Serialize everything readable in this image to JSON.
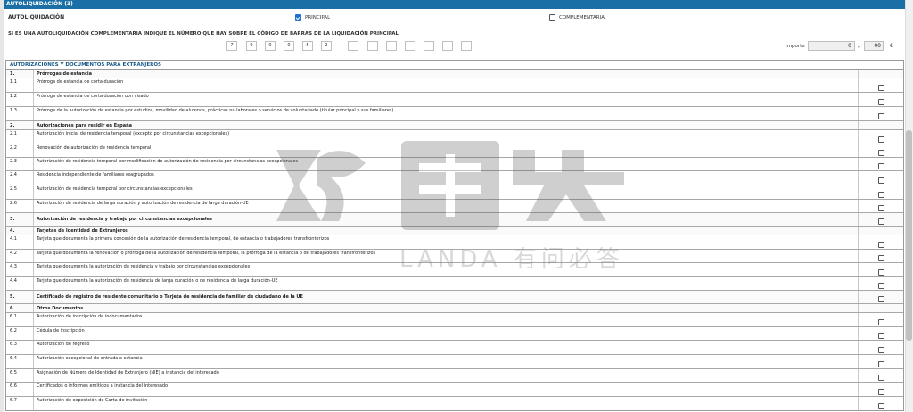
{
  "header": {
    "title": "AUTOLIQUIDACIÓN (3)"
  },
  "autoliquidacion": {
    "label": "AUTOLIQUIDACIÓN",
    "principal_label": "PRINCIPAL",
    "principal_checked": true,
    "complementaria_label": "COMPLEMENTARIA",
    "complementaria_checked": false
  },
  "complementaria_note": "SI ES UNA AUTOLIQUIDACIÓN COMPLEMENTARIA INDIQUE EL NÚMERO QUE HAY SOBRE EL CÓDIGO DE BARRAS DE LA LIQUIDACIÓN PRINCIPAL",
  "barcode_digits": [
    "7",
    "9",
    "0",
    "0",
    "5",
    "2",
    "",
    "",
    "",
    "",
    "",
    "",
    ""
  ],
  "importe": {
    "label": "Importe",
    "integer": "0",
    "separator": ",",
    "decimal": "00",
    "currency": "€"
  },
  "autorizaciones": {
    "title": "AUTORIZACIONES Y DOCUMENTOS PARA EXTRANJEROS",
    "rows": [
      {
        "num": "1.",
        "desc": "Prórrogas de estancia",
        "category": true,
        "checkbox": false,
        "h": 10
      },
      {
        "num": "1.1",
        "desc": "Prórroga de estancia de corta duración",
        "category": false,
        "checkbox": true,
        "h": 16
      },
      {
        "num": "1.2",
        "desc": "Prórroga de estancia de corta duración con visado",
        "category": false,
        "checkbox": true,
        "h": 16
      },
      {
        "num": "1.3",
        "desc": "Prórroga de la autorización de estancia por estudios, movilidad de alumnos, prácticas no laborales o servicios de voluntariado (titular principal y sus familiares)",
        "category": false,
        "checkbox": true,
        "h": 16
      },
      {
        "num": "2.",
        "desc": "Autorizaciones para residir en España",
        "category": true,
        "checkbox": false,
        "h": 10
      },
      {
        "num": "2.1",
        "desc": "Autorización inicial de residencia temporal (excepto por circunstancias excepcionales)",
        "category": false,
        "checkbox": true,
        "h": 16
      },
      {
        "num": "2.2",
        "desc": "Renovación de autorización de residencia temporal",
        "category": false,
        "checkbox": true,
        "h": 15
      },
      {
        "num": "2.3",
        "desc": "Autorización de residencia temporal por modificación de autorización de residencia por circunstancias excepcionales",
        "category": false,
        "checkbox": true,
        "h": 15
      },
      {
        "num": "2.4",
        "desc": "Residencia independiente de familiares reagrupados",
        "category": false,
        "checkbox": true,
        "h": 16
      },
      {
        "num": "2.5",
        "desc": "Autorización de residencia temporal por circunstancias excepcionales",
        "category": false,
        "checkbox": true,
        "h": 16
      },
      {
        "num": "2.6",
        "desc": "Autorización de residencia de larga duración y autorización de residencia de larga duración-UE",
        "category": false,
        "checkbox": true,
        "h": 15
      },
      {
        "num": "3.",
        "desc": "Autorización de residencia y trabajo por circunstancias excepcionales",
        "category": true,
        "checkbox": true,
        "h": 15
      },
      {
        "num": "4.",
        "desc": "Tarjetas de Identidad de Extranjeros",
        "category": true,
        "checkbox": false,
        "h": 10
      },
      {
        "num": "4.1",
        "desc": "Tarjeta que documenta la primera concesión de la autorización de residencia temporal, de estancia o trabajadores transfronterizos",
        "category": false,
        "checkbox": true,
        "h": 16
      },
      {
        "num": "4.2",
        "desc": "Tarjeta que documenta la renovación o prórroga de la autorización de residencia temporal, la prórroga de la estancia o de trabajadores transfronterizos",
        "category": false,
        "checkbox": true,
        "h": 15
      },
      {
        "num": "4.3",
        "desc": "Tarjeta que documenta la autorización de residencia y trabajo por circunstancias excepcionales",
        "category": false,
        "checkbox": true,
        "h": 16
      },
      {
        "num": "4.4",
        "desc": "Tarjeta que documenta la autorización de residencia de larga duración o de residencia de larga duración-UE",
        "category": false,
        "checkbox": true,
        "h": 15
      },
      {
        "num": "5.",
        "desc": "Certificado de registro de residente comunitario o Tarjeta de residencia de familiar de ciudadano de la UE",
        "category": true,
        "checkbox": true,
        "h": 15
      },
      {
        "num": "6.",
        "desc": "Otros Documentos",
        "category": true,
        "checkbox": false,
        "h": 10
      },
      {
        "num": "6.1",
        "desc": "Autorización de inscripción de indocumentados",
        "category": false,
        "checkbox": true,
        "h": 16
      },
      {
        "num": "6.2",
        "desc": "Cédula de inscripción",
        "category": false,
        "checkbox": true,
        "h": 15
      },
      {
        "num": "6.3",
        "desc": "Autorización de regreso",
        "category": false,
        "checkbox": true,
        "h": 16
      },
      {
        "num": "6.4",
        "desc": "Autorización excepcional de entrada o estancia",
        "category": false,
        "checkbox": true,
        "h": 16
      },
      {
        "num": "6.5",
        "desc": "Asignación de Número de Identidad de Extranjero (NIE) a instancia del interesado",
        "category": false,
        "checkbox": true,
        "h": 15
      },
      {
        "num": "6.6",
        "desc": "Certificados o informes emitidos a instancia del interesado",
        "category": false,
        "checkbox": true,
        "h": 16
      },
      {
        "num": "6.7",
        "desc": "Autorización de expedición de Carta de invitación",
        "category": false,
        "checkbox": true,
        "h": 15
      }
    ]
  },
  "watermark": {
    "text": "LANDA 有问必答"
  }
}
